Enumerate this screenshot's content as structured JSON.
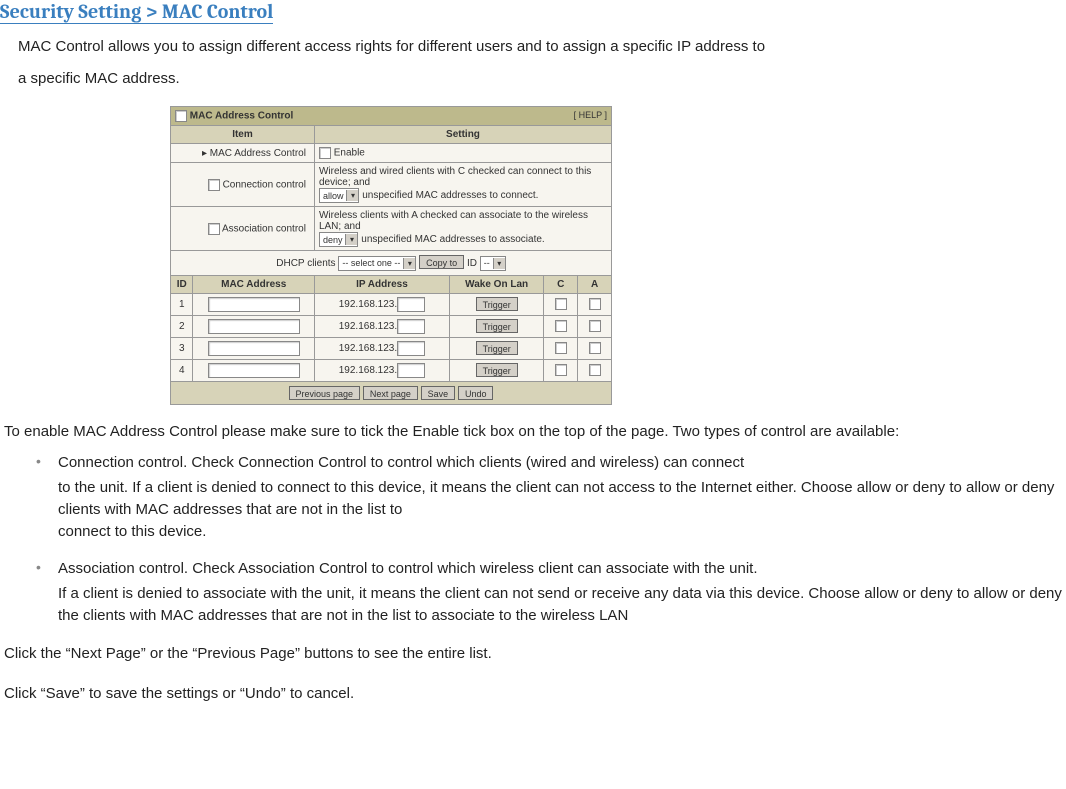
{
  "title": "Security Setting > MAC Control",
  "intro_line1": "MAC Control allows you to assign different access rights for different users and to assign a specific IP address to",
  "intro_line2": "a specific MAC address.",
  "router": {
    "panel_title": "MAC Address Control",
    "help_link": "[ HELP ]",
    "col_item": "Item",
    "col_setting": "Setting",
    "row_mac_label": "▸ MAC Address Control",
    "enable_label": "Enable",
    "row_conn_label": "Connection control",
    "conn_text1": "Wireless and wired clients with C checked can connect to this device; and",
    "conn_select": "allow",
    "conn_text2": " unspecified MAC addresses to connect.",
    "row_assoc_label": "Association control",
    "assoc_text1": "Wireless clients with A checked can associate to the wireless LAN; and",
    "assoc_select": "deny",
    "assoc_text2": " unspecified MAC addresses to associate.",
    "dhcp_label": "DHCP clients",
    "dhcp_select": "-- select one --",
    "copy_to_btn": "Copy to",
    "id_label": "ID",
    "id_select": "--",
    "grid": {
      "h_id": "ID",
      "h_mac": "MAC Address",
      "h_ip": "IP Address",
      "h_wol": "Wake On Lan",
      "h_c": "C",
      "h_a": "A",
      "ip_prefix": "192.168.123.",
      "trigger_btn": "Trigger",
      "rows": [
        "1",
        "2",
        "3",
        "4"
      ]
    },
    "btn_prev": "Previous page",
    "btn_next": "Next page",
    "btn_save": "Save",
    "btn_undo": "Undo"
  },
  "para_enable": "To enable MAC Address Control please make sure to tick the Enable tick box on the top of the page. Two types of control are available:",
  "bullets": {
    "conn_head": "Connection control. Check Connection Control to control which clients (wired and wireless) can connect",
    "conn_body": "to the unit. If a client is denied to connect to this device, it means the client can not access to the Internet either. Choose allow or deny to allow or deny clients with MAC addresses that are not in the list to\nconnect to this device.",
    "assoc_head": "Association control. Check Association Control to control which wireless client can associate with the unit.",
    "assoc_body": "If a client is denied to associate with the unit, it means the client can not send or receive any data via this device. Choose allow or deny to allow or deny the clients with MAC addresses that are not in the list to associate to the wireless LAN"
  },
  "para_nav": "Click the “Next Page” or the “Previous Page” buttons to see the entire list.",
  "para_save": "Click “Save” to save the settings or “Undo” to cancel."
}
